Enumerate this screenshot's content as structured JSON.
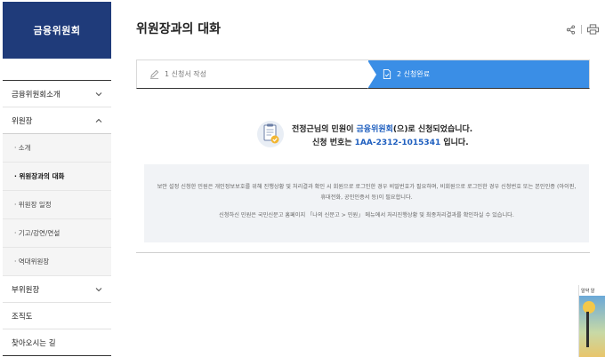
{
  "sidebar": {
    "brand": "금융위원회",
    "items": [
      {
        "label": "금융위원회소개",
        "expanded": false
      },
      {
        "label": "위원장",
        "expanded": true
      },
      {
        "label": "부위원장",
        "expanded": false
      },
      {
        "label": "조직도"
      },
      {
        "label": "찾아오시는 길"
      }
    ],
    "sub_items": [
      {
        "label": "· 소개"
      },
      {
        "label": "· 위원장과의 대화",
        "active": true
      },
      {
        "label": "· 위원장 일정"
      },
      {
        "label": "· 기고/강연/연설"
      },
      {
        "label": "· 역대위원장"
      }
    ]
  },
  "main": {
    "title": "위원장과의 대화",
    "steps": [
      {
        "label": "1 신청서 작성",
        "state": "done"
      },
      {
        "label": "2 신청완료",
        "state": "current"
      }
    ],
    "result": {
      "line1_pre": "전정근님의 민원이 ",
      "line1_org": "금융위원회",
      "line1_post": "(으)로 신청되었습니다.",
      "line2_pre": "신청 번호는 ",
      "line2_number": "1AA-2312-1015341",
      "line2_post": " 입니다."
    },
    "notice": {
      "p1": "보안 설정 신청한 민원은 개인정보보호를 위해 진행상황 및 처리결과 확인 시 회원으로 로그인한 경우 비밀번호가 필요하며, 비회원으로 로그인한 경우 신청번호 또는 본인인증 (아이핀, 휴대전화, 공인인증서 등)이 필요합니다.",
      "p2": "신청하신 민원은 국민신문고 홈페이지 「나의 신문고 > 민원」 메뉴에서 처리진행상황 및 최종처리결과를 확인하실 수 있습니다."
    }
  },
  "banner": {
    "label": "알약 알"
  },
  "colors": {
    "brand_navy": "#1f3b7a",
    "step_active": "#3a8ee6",
    "highlight_text": "#1f5fbf"
  }
}
